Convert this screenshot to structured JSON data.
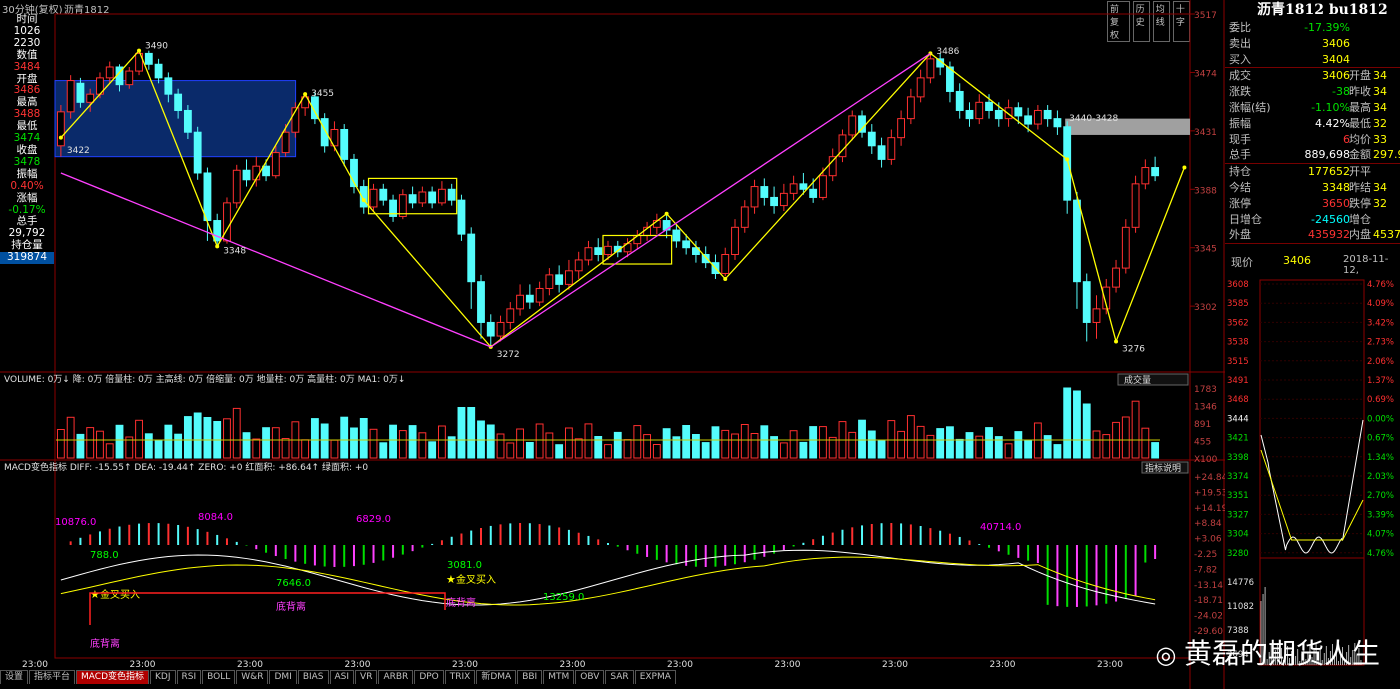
{
  "window": {
    "title": "30分钟(复权)",
    "symbol": "沥青1812",
    "buttons": [
      "前复权",
      "历史",
      "均线",
      "十字"
    ]
  },
  "left_panel": [
    {
      "label": "时间",
      "value": "1026",
      "value2": "2230"
    },
    {
      "label": "数值",
      "value": "3484"
    },
    {
      "label": "开盘",
      "value": "3486"
    },
    {
      "label": "最高",
      "value": "3488"
    },
    {
      "label": "最低",
      "value": "3474"
    },
    {
      "label": "收盘",
      "value": "3478"
    },
    {
      "label": "振幅",
      "value": "0.40%"
    },
    {
      "label": "涨幅",
      "value": "-0.17%"
    },
    {
      "label": "总手",
      "value": "29,792"
    },
    {
      "label": "持仓量",
      "value": "319874"
    }
  ],
  "quote": {
    "title": "沥青1812 bu1812",
    "rows": [
      {
        "k": "委比",
        "v": "-17.39%",
        "c": "grn"
      },
      {
        "k": "卖出",
        "v": "3406",
        "c": "yel"
      },
      {
        "k": "买入",
        "v": "3404",
        "c": "yel"
      },
      {
        "k": "成交",
        "v": "3406",
        "c": "yel",
        "k2": "开盘",
        "v2": "34"
      },
      {
        "k": "涨跌",
        "v": "-38",
        "c": "grn",
        "k2": "昨收",
        "v2": "34"
      },
      {
        "k": "涨幅(结)",
        "v": "-1.10%",
        "c": "grn",
        "k2": "最高",
        "v2": "34"
      },
      {
        "k": "振幅",
        "v": "4.42%",
        "c": "wht",
        "k2": "最低",
        "v2": "32"
      },
      {
        "k": "现手",
        "v": "6",
        "c": "red",
        "k2": "均价",
        "v2": "33"
      },
      {
        "k": "总手",
        "v": "889,698",
        "c": "wht",
        "k2": "金额",
        "v2": "297.9"
      },
      {
        "k": "持仓",
        "v": "177652",
        "c": "yel",
        "k2": "开平",
        "v2": ""
      },
      {
        "k": "今结",
        "v": "3348",
        "c": "yel",
        "k2": "昨结",
        "v2": "34"
      },
      {
        "k": "涨停",
        "v": "3650",
        "c": "red",
        "k2": "跌停",
        "v2": "32"
      },
      {
        "k": "日增仓",
        "v": "-24560",
        "c": "cyn",
        "k2": "增仓",
        "v2": ""
      },
      {
        "k": "外盘",
        "v": "435932",
        "c": "red",
        "k2": "内盘",
        "v2": "4537"
      }
    ],
    "now_label": "现价",
    "now_value": "3406",
    "date": "2018-11-12,"
  },
  "mini_chart": {
    "left_ticks": [
      "3608",
      "3585",
      "3562",
      "3538",
      "3515",
      "3491",
      "3468",
      "3444",
      "3421",
      "3398",
      "3374",
      "3351",
      "3327",
      "3304",
      "3280"
    ],
    "right_ticks": [
      "4.76%",
      "4.09%",
      "3.42%",
      "2.73%",
      "2.06%",
      "1.37%",
      "0.69%",
      "0.00%",
      "0.67%",
      "1.34%",
      "2.03%",
      "2.70%",
      "3.39%",
      "4.07%",
      "4.76%"
    ],
    "vol_ticks": [
      "14776",
      "11082",
      "7388",
      "3694"
    ]
  },
  "chart_data": [
    {
      "type": "candlestick",
      "title": "沥青1812 30分钟",
      "y_ticks": [
        3517,
        3474,
        3431,
        3388,
        3345,
        3302
      ],
      "ylim": [
        3255,
        3517
      ],
      "pivot_labels": [
        {
          "text": "3490",
          "value": 3490
        },
        {
          "text": "3422",
          "value": 3422
        },
        {
          "text": "3455",
          "value": 3455
        },
        {
          "text": "3348",
          "value": 3348
        },
        {
          "text": "3272",
          "value": 3272
        },
        {
          "text": "3486",
          "value": 3486
        },
        {
          "text": "3276",
          "value": 3276
        },
        {
          "text": "3440-3428",
          "value": 3434
        }
      ],
      "candles": [
        [
          3420,
          3445,
          3412,
          3450
        ],
        [
          3445,
          3468,
          3440,
          3472
        ],
        [
          3466,
          3452,
          3448,
          3470
        ],
        [
          3452,
          3458,
          3445,
          3462
        ],
        [
          3458,
          3470,
          3455,
          3474
        ],
        [
          3470,
          3478,
          3466,
          3482
        ],
        [
          3478,
          3465,
          3460,
          3480
        ],
        [
          3465,
          3475,
          3462,
          3478
        ],
        [
          3475,
          3488,
          3472,
          3490
        ],
        [
          3488,
          3480,
          3476,
          3490
        ],
        [
          3480,
          3470,
          3466,
          3484
        ],
        [
          3470,
          3458,
          3452,
          3474
        ],
        [
          3458,
          3446,
          3440,
          3462
        ],
        [
          3446,
          3430,
          3425,
          3450
        ],
        [
          3430,
          3400,
          3395,
          3434
        ],
        [
          3400,
          3365,
          3350,
          3404
        ],
        [
          3365,
          3350,
          3346,
          3370
        ],
        [
          3350,
          3378,
          3348,
          3382
        ],
        [
          3378,
          3402,
          3374,
          3406
        ],
        [
          3402,
          3395,
          3390,
          3410
        ],
        [
          3395,
          3405,
          3390,
          3412
        ],
        [
          3405,
          3398,
          3394,
          3410
        ],
        [
          3398,
          3415,
          3396,
          3420
        ],
        [
          3415,
          3430,
          3412,
          3436
        ],
        [
          3430,
          3448,
          3426,
          3452
        ],
        [
          3448,
          3456,
          3442,
          3458
        ],
        [
          3456,
          3440,
          3436,
          3460
        ],
        [
          3440,
          3420,
          3415,
          3444
        ],
        [
          3420,
          3432,
          3416,
          3438
        ],
        [
          3432,
          3410,
          3405,
          3436
        ],
        [
          3410,
          3390,
          3385,
          3414
        ],
        [
          3390,
          3375,
          3370,
          3395
        ],
        [
          3375,
          3388,
          3372,
          3392
        ],
        [
          3388,
          3380,
          3376,
          3392
        ],
        [
          3380,
          3368,
          3364,
          3384
        ],
        [
          3368,
          3384,
          3366,
          3388
        ],
        [
          3384,
          3378,
          3374,
          3390
        ],
        [
          3378,
          3386,
          3375,
          3390
        ],
        [
          3386,
          3378,
          3374,
          3390
        ],
        [
          3378,
          3388,
          3376,
          3394
        ],
        [
          3388,
          3380,
          3376,
          3392
        ],
        [
          3380,
          3355,
          3350,
          3384
        ],
        [
          3355,
          3320,
          3300,
          3360
        ],
        [
          3320,
          3290,
          3278,
          3325
        ],
        [
          3290,
          3280,
          3272,
          3296
        ],
        [
          3280,
          3290,
          3276,
          3295
        ],
        [
          3290,
          3300,
          3285,
          3305
        ],
        [
          3300,
          3310,
          3295,
          3318
        ],
        [
          3310,
          3305,
          3300,
          3318
        ],
        [
          3305,
          3315,
          3302,
          3320
        ],
        [
          3315,
          3325,
          3310,
          3330
        ],
        [
          3325,
          3318,
          3312,
          3332
        ],
        [
          3318,
          3328,
          3314,
          3336
        ],
        [
          3328,
          3336,
          3322,
          3342
        ],
        [
          3336,
          3345,
          3332,
          3350
        ],
        [
          3345,
          3340,
          3335,
          3352
        ],
        [
          3340,
          3346,
          3336,
          3350
        ],
        [
          3346,
          3342,
          3338,
          3350
        ],
        [
          3342,
          3348,
          3338,
          3352
        ],
        [
          3348,
          3354,
          3344,
          3358
        ],
        [
          3354,
          3360,
          3350,
          3364
        ],
        [
          3360,
          3365,
          3355,
          3370
        ],
        [
          3365,
          3358,
          3352,
          3370
        ],
        [
          3358,
          3350,
          3345,
          3362
        ],
        [
          3350,
          3345,
          3340,
          3355
        ],
        [
          3345,
          3340,
          3334,
          3350
        ],
        [
          3340,
          3334,
          3330,
          3346
        ],
        [
          3334,
          3326,
          3322,
          3340
        ],
        [
          3326,
          3340,
          3324,
          3345
        ],
        [
          3340,
          3360,
          3336,
          3366
        ],
        [
          3360,
          3375,
          3356,
          3380
        ],
        [
          3375,
          3390,
          3370,
          3395
        ],
        [
          3390,
          3382,
          3376,
          3396
        ],
        [
          3382,
          3376,
          3370,
          3390
        ],
        [
          3376,
          3385,
          3372,
          3392
        ],
        [
          3385,
          3392,
          3380,
          3398
        ],
        [
          3392,
          3388,
          3384,
          3400
        ],
        [
          3388,
          3382,
          3378,
          3396
        ],
        [
          3382,
          3398,
          3380,
          3404
        ],
        [
          3398,
          3412,
          3394,
          3418
        ],
        [
          3412,
          3428,
          3408,
          3432
        ],
        [
          3428,
          3442,
          3424,
          3446
        ],
        [
          3442,
          3430,
          3426,
          3446
        ],
        [
          3430,
          3420,
          3414,
          3436
        ],
        [
          3420,
          3410,
          3404,
          3426
        ],
        [
          3410,
          3426,
          3406,
          3432
        ],
        [
          3426,
          3440,
          3420,
          3446
        ],
        [
          3440,
          3456,
          3436,
          3462
        ],
        [
          3456,
          3470,
          3452,
          3476
        ],
        [
          3470,
          3484,
          3466,
          3488
        ],
        [
          3484,
          3478,
          3472,
          3488
        ],
        [
          3478,
          3460,
          3452,
          3482
        ],
        [
          3460,
          3446,
          3440,
          3466
        ],
        [
          3446,
          3440,
          3434,
          3452
        ],
        [
          3440,
          3452,
          3436,
          3458
        ],
        [
          3452,
          3446,
          3440,
          3458
        ],
        [
          3446,
          3440,
          3434,
          3452
        ],
        [
          3440,
          3448,
          3434,
          3454
        ],
        [
          3448,
          3442,
          3436,
          3452
        ],
        [
          3442,
          3436,
          3430,
          3448
        ],
        [
          3436,
          3446,
          3432,
          3450
        ],
        [
          3446,
          3440,
          3434,
          3450
        ],
        [
          3440,
          3434,
          3428,
          3446
        ],
        [
          3434,
          3380,
          3370,
          3438
        ],
        [
          3380,
          3320,
          3300,
          3386
        ],
        [
          3320,
          3290,
          3276,
          3326
        ],
        [
          3290,
          3300,
          3278,
          3310
        ],
        [
          3300,
          3316,
          3296,
          3322
        ],
        [
          3316,
          3330,
          3312,
          3336
        ],
        [
          3330,
          3360,
          3326,
          3366
        ],
        [
          3360,
          3392,
          3356,
          3398
        ],
        [
          3392,
          3404,
          3388,
          3410
        ],
        [
          3404,
          3398,
          3394,
          3412
        ]
      ]
    },
    {
      "type": "bar",
      "title": "VOLUME: 0万↓ 降: 0万 倍量柱: 0万 主高线: 0万 倍缩量: 0万 地量柱: 0万 高量柱: 0万 MA1: 0万↓",
      "y_ticks": [
        "1783",
        "1346",
        "891",
        "455",
        "X100"
      ],
      "legend_button": "成交量"
    },
    {
      "type": "bar",
      "title": "MACD变色指标 DIFF: -15.55↑ DEA: -19.44↑ ZERO: +0 红面积: +86.64↑ 绿面积: +0",
      "y_ticks": [
        "+24.84",
        "+19.53",
        "+14.19",
        "+8.84",
        "+3.06",
        "-2.25",
        "-7.82",
        "-13.14",
        "-18.71",
        "-24.02",
        "-29.60"
      ],
      "area_labels": [
        {
          "text": "10876.0",
          "color": "#ff00ff"
        },
        {
          "text": "788.0",
          "color": "#00ff00"
        },
        {
          "text": "8084.0",
          "color": "#ff00ff"
        },
        {
          "text": "7646.0",
          "color": "#00ff00"
        },
        {
          "text": "6829.0",
          "color": "#ff00ff"
        },
        {
          "text": "3081.0",
          "color": "#00ff00"
        },
        {
          "text": "13259.0",
          "color": "#00ff00"
        },
        {
          "text": "40714.0",
          "color": "#ff00ff"
        }
      ],
      "signals": [
        {
          "text": "金叉买入"
        },
        {
          "text": "底背离"
        },
        {
          "text": "底背离"
        },
        {
          "text": "金叉买入"
        },
        {
          "text": "底背离"
        }
      ],
      "legend_button": "指标说明"
    }
  ],
  "time_axis": [
    "23:00",
    "23:00",
    "23:00",
    "23:00",
    "23:00",
    "23:00",
    "23:00",
    "23:00",
    "23:00",
    "23:00",
    "23:00"
  ],
  "tabs": [
    "设置",
    "指标平台",
    "MACD变色指标",
    "KDJ",
    "RSI",
    "BOLL",
    "W&R",
    "DMI",
    "BIAS",
    "ASI",
    "VR",
    "ARBR",
    "DPO",
    "TRIX",
    "新DMA",
    "BBI",
    "MTM",
    "OBV",
    "SAR",
    "EXPMA"
  ],
  "active_tab": "MACD变色指标",
  "watermark": "黄磊的期货人生"
}
